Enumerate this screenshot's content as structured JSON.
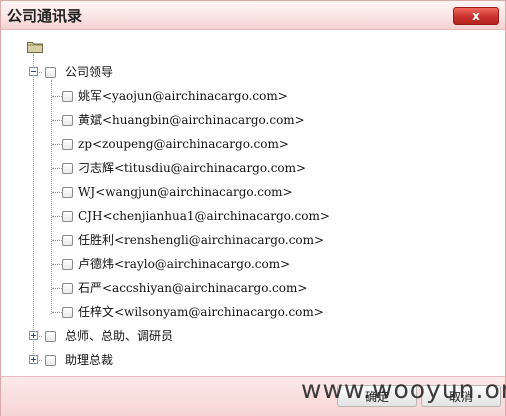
{
  "window": {
    "title": "公司通讯录",
    "close_glyph": "x"
  },
  "tree": {
    "groups": [
      {
        "label": "公司领导",
        "expanded": true,
        "members": [
          "姚军<yaojun@airchinacargo.com>",
          "黄斌<huangbin@airchinacargo.com>",
          "zp<zoupeng@airchinacargo.com>",
          "刁志辉<titusdiu@airchinacargo.com>",
          "WJ<wangjun@airchinacargo.com>",
          "CJH<chenjianhua1@airchinacargo.com>",
          "任胜利<renshengli@airchinacargo.com>",
          "卢德炜<raylo@airchinacargo.com>",
          "石严<accshiyan@airchinacargo.com>",
          "任梓文<wilsonyam@airchinacargo.com>"
        ]
      },
      {
        "label": "总师、总助、调研员",
        "expanded": false,
        "members": []
      },
      {
        "label": "助理总裁",
        "expanded": false,
        "members": []
      }
    ]
  },
  "footer": {
    "confirm_label": "确定",
    "cancel_label": "取消"
  },
  "watermark": "www.wooyun.org",
  "colors": {
    "titlebar": "#fbe3e3",
    "close_button": "#c9302c",
    "footer": "#f6d4d4"
  }
}
